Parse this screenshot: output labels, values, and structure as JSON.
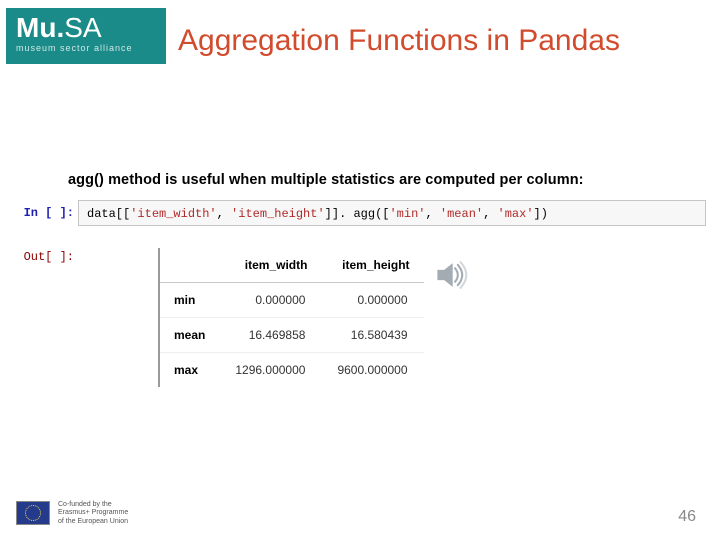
{
  "logo": {
    "main_pre": "Mu",
    "main_dot": ".",
    "main_post": "SA",
    "sub": "museum sector alliance"
  },
  "title": "Aggregation Functions in Pandas",
  "description": "agg() method is useful when multiple statistics are computed per column:",
  "code": {
    "prompt": "In [ ]:",
    "text_prefix": "data[[",
    "str1": "'item_width'",
    "comma1": ", ",
    "str2": "'item_height'",
    "mid": "]]. agg([",
    "str3": "'min'",
    "comma2": ", ",
    "str4": "'mean'",
    "comma3": ", ",
    "str5": "'max'",
    "suffix": "])"
  },
  "output": {
    "prompt": "Out[ ]:"
  },
  "footer": {
    "line1": "Co-funded by the",
    "line2": "Erasmus+ Programme",
    "line3": "of the European Union"
  },
  "page": "46",
  "chart_data": {
    "type": "table",
    "columns": [
      "item_width",
      "item_height"
    ],
    "rows": [
      {
        "label": "min",
        "item_width": "0.000000",
        "item_height": "0.000000"
      },
      {
        "label": "mean",
        "item_width": "16.469858",
        "item_height": "16.580439"
      },
      {
        "label": "max",
        "item_width": "1296.000000",
        "item_height": "9600.000000"
      }
    ]
  }
}
